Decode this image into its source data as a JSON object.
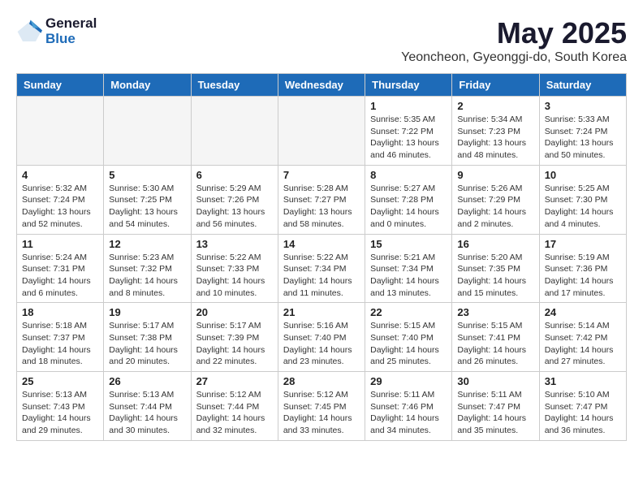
{
  "logo": {
    "general": "General",
    "blue": "Blue"
  },
  "title": "May 2025",
  "location": "Yeoncheon, Gyeonggi-do, South Korea",
  "weekdays": [
    "Sunday",
    "Monday",
    "Tuesday",
    "Wednesday",
    "Thursday",
    "Friday",
    "Saturday"
  ],
  "weeks": [
    [
      {
        "day": "",
        "empty": true
      },
      {
        "day": "",
        "empty": true
      },
      {
        "day": "",
        "empty": true
      },
      {
        "day": "",
        "empty": true
      },
      {
        "day": "1",
        "sunrise": "5:35 AM",
        "sunset": "7:22 PM",
        "daylight": "13 hours and 46 minutes."
      },
      {
        "day": "2",
        "sunrise": "5:34 AM",
        "sunset": "7:23 PM",
        "daylight": "13 hours and 48 minutes."
      },
      {
        "day": "3",
        "sunrise": "5:33 AM",
        "sunset": "7:24 PM",
        "daylight": "13 hours and 50 minutes."
      }
    ],
    [
      {
        "day": "4",
        "sunrise": "5:32 AM",
        "sunset": "7:24 PM",
        "daylight": "13 hours and 52 minutes."
      },
      {
        "day": "5",
        "sunrise": "5:30 AM",
        "sunset": "7:25 PM",
        "daylight": "13 hours and 54 minutes."
      },
      {
        "day": "6",
        "sunrise": "5:29 AM",
        "sunset": "7:26 PM",
        "daylight": "13 hours and 56 minutes."
      },
      {
        "day": "7",
        "sunrise": "5:28 AM",
        "sunset": "7:27 PM",
        "daylight": "13 hours and 58 minutes."
      },
      {
        "day": "8",
        "sunrise": "5:27 AM",
        "sunset": "7:28 PM",
        "daylight": "14 hours and 0 minutes."
      },
      {
        "day": "9",
        "sunrise": "5:26 AM",
        "sunset": "7:29 PM",
        "daylight": "14 hours and 2 minutes."
      },
      {
        "day": "10",
        "sunrise": "5:25 AM",
        "sunset": "7:30 PM",
        "daylight": "14 hours and 4 minutes."
      }
    ],
    [
      {
        "day": "11",
        "sunrise": "5:24 AM",
        "sunset": "7:31 PM",
        "daylight": "14 hours and 6 minutes."
      },
      {
        "day": "12",
        "sunrise": "5:23 AM",
        "sunset": "7:32 PM",
        "daylight": "14 hours and 8 minutes."
      },
      {
        "day": "13",
        "sunrise": "5:22 AM",
        "sunset": "7:33 PM",
        "daylight": "14 hours and 10 minutes."
      },
      {
        "day": "14",
        "sunrise": "5:22 AM",
        "sunset": "7:34 PM",
        "daylight": "14 hours and 11 minutes."
      },
      {
        "day": "15",
        "sunrise": "5:21 AM",
        "sunset": "7:34 PM",
        "daylight": "14 hours and 13 minutes."
      },
      {
        "day": "16",
        "sunrise": "5:20 AM",
        "sunset": "7:35 PM",
        "daylight": "14 hours and 15 minutes."
      },
      {
        "day": "17",
        "sunrise": "5:19 AM",
        "sunset": "7:36 PM",
        "daylight": "14 hours and 17 minutes."
      }
    ],
    [
      {
        "day": "18",
        "sunrise": "5:18 AM",
        "sunset": "7:37 PM",
        "daylight": "14 hours and 18 minutes."
      },
      {
        "day": "19",
        "sunrise": "5:17 AM",
        "sunset": "7:38 PM",
        "daylight": "14 hours and 20 minutes."
      },
      {
        "day": "20",
        "sunrise": "5:17 AM",
        "sunset": "7:39 PM",
        "daylight": "14 hours and 22 minutes."
      },
      {
        "day": "21",
        "sunrise": "5:16 AM",
        "sunset": "7:40 PM",
        "daylight": "14 hours and 23 minutes."
      },
      {
        "day": "22",
        "sunrise": "5:15 AM",
        "sunset": "7:40 PM",
        "daylight": "14 hours and 25 minutes."
      },
      {
        "day": "23",
        "sunrise": "5:15 AM",
        "sunset": "7:41 PM",
        "daylight": "14 hours and 26 minutes."
      },
      {
        "day": "24",
        "sunrise": "5:14 AM",
        "sunset": "7:42 PM",
        "daylight": "14 hours and 27 minutes."
      }
    ],
    [
      {
        "day": "25",
        "sunrise": "5:13 AM",
        "sunset": "7:43 PM",
        "daylight": "14 hours and 29 minutes."
      },
      {
        "day": "26",
        "sunrise": "5:13 AM",
        "sunset": "7:44 PM",
        "daylight": "14 hours and 30 minutes."
      },
      {
        "day": "27",
        "sunrise": "5:12 AM",
        "sunset": "7:44 PM",
        "daylight": "14 hours and 32 minutes."
      },
      {
        "day": "28",
        "sunrise": "5:12 AM",
        "sunset": "7:45 PM",
        "daylight": "14 hours and 33 minutes."
      },
      {
        "day": "29",
        "sunrise": "5:11 AM",
        "sunset": "7:46 PM",
        "daylight": "14 hours and 34 minutes."
      },
      {
        "day": "30",
        "sunrise": "5:11 AM",
        "sunset": "7:47 PM",
        "daylight": "14 hours and 35 minutes."
      },
      {
        "day": "31",
        "sunrise": "5:10 AM",
        "sunset": "7:47 PM",
        "daylight": "14 hours and 36 minutes."
      }
    ]
  ]
}
